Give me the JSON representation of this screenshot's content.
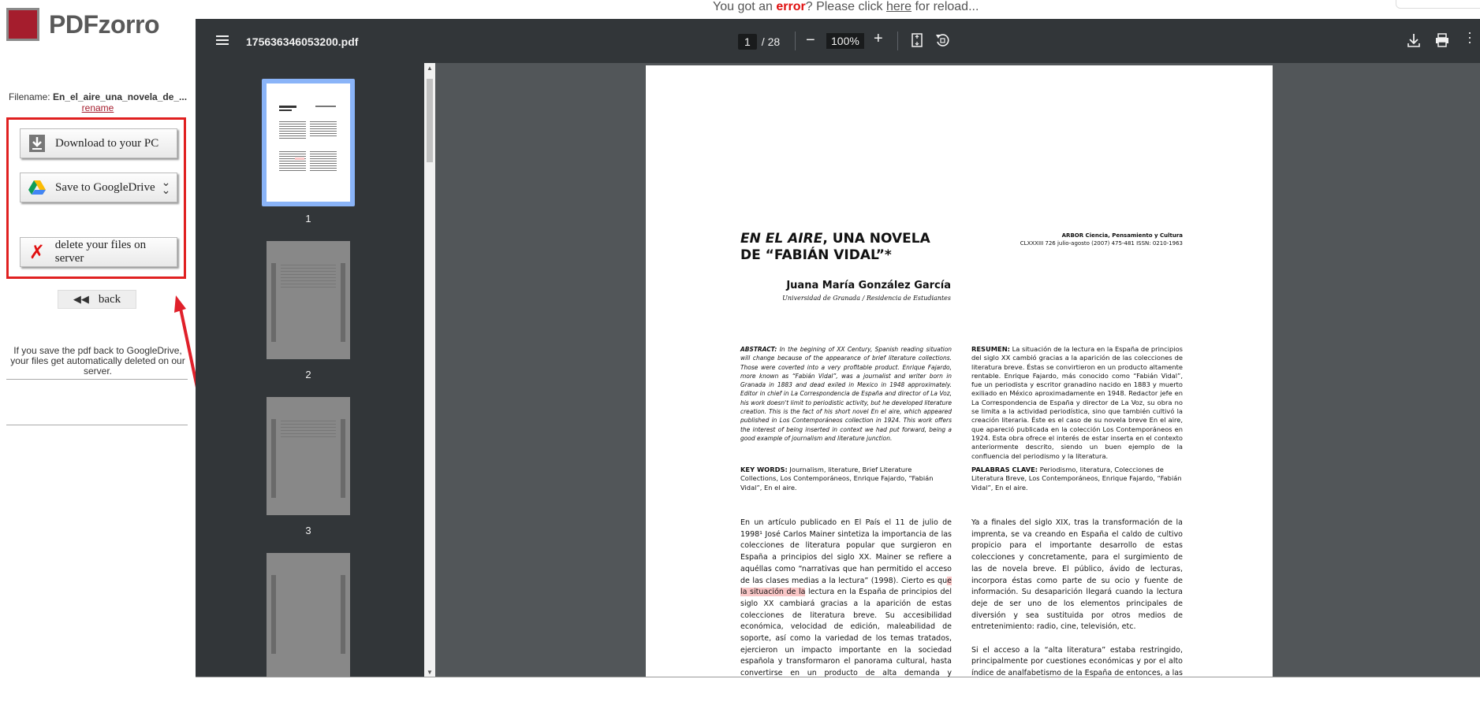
{
  "brand": {
    "name": "PDFzorro"
  },
  "notice": {
    "prefix": "You got an ",
    "error": "error",
    "middle": "? Please click ",
    "link": "here",
    "suffix": " for reload..."
  },
  "left": {
    "filename_label": "Filename:",
    "filename_value": "En_el_aire_una_novela_de_...",
    "rename": "rename",
    "download": "Download to your PC",
    "gdrive": "Save to GoogleDrive",
    "delete": "delete your files on server",
    "back": "back",
    "note": "If you save the pdf back to GoogleDrive, your files get automatically deleted on our server."
  },
  "viewer": {
    "file": "175636346053200.pdf",
    "page_current": "1",
    "page_total": "/ 28",
    "zoom": "100%",
    "thumb_labels": [
      "1",
      "2",
      "3"
    ]
  },
  "doc": {
    "title_italic": "EN EL AIRE",
    "title_rest": ", UNA NOVELA",
    "title_line2": "DE “FABIÁN VIDAL”*",
    "arbor1": "ARBOR Ciencia, Pensamiento y Cultura",
    "arbor2": "CLXXXIII 726 julio-agosto (2007) 475-481 ISSN: 0210-1963",
    "author": "Juana María González García",
    "affiliation": "Universidad de Granada / Residencia de Estudiantes",
    "abstract_label": "ABSTRACT:",
    "abstract": "In the begining of XX Century, Spanish reading situation will change because of the appearance of brief literature collections. Those were coverted into a very profitable product. Enrique Fajardo, more known as “Fabián Vidal”, was a journalist and writer born in Granada in 1883 and dead exiled in Mexico in 1948 approximately. Editor in chief in La Correspondencia de España and director of La Voz, his work doesn't limit to periodistic activity, but he developed literature creation. This is the fact of his short novel En el aire, which appeared published in Los Contemporáneos collection in 1924. This work offers the interest of being inserted in context we had put forward, being a good example of journalism and literature junction.",
    "keywords_label": "KEY WORDS:",
    "keywords": "Journalism, literature, Brief Literature Collections, Los Contemporáneos, Enrique Fajardo, “Fabián Vidal”, En el aire.",
    "resumen_label": "RESUMEN:",
    "resumen": "La situación de la lectura en la España de principios del siglo XX cambió gracias a la aparición de las colecciones de literatura breve. Éstas se convirtieron en un producto altamente rentable. Enrique Fajardo, más conocido como “Fabián Vidal”, fue un periodista y escritor granadino nacido en 1883 y muerto exiliado en México aproximadamente en 1948. Redactor jefe en La Correspondencia de España y director de La Voz, su obra no se limita a la actividad periodística, sino que también cultivó la creación literaria. Éste es el caso de su novela breve En el aire, que apareció publicada en la colección Los Contemporáneos en 1924. Esta obra ofrece el interés de estar inserta en el contexto anteriormente descrito, siendo un buen ejemplo de la confluencia del periodismo y la literatura.",
    "palabras_label": "PALABRAS CLAVE:",
    "palabras": "Periodismo, literatura, Colecciones de Literatura Breve, Los Contemporáneos, Enrique Fajardo, “Fabián Vidal”, En el aire.",
    "body1a": "En un artículo publicado en El País el 11 de julio de 1998¹ José Carlos Mainer sintetiza la importancia de las colecciones de literatura popular que surgieron en España a principios del siglo XX. Mainer se refiere a aquéllas como “narrativas que han permitido el acceso de las clases medias a la lectura” (1998). Cierto es qu",
    "body1hl": "e la situación de la",
    "body1b": " lectura en la España de principios del siglo XX cambiará gracias a la aparición de estas colecciones de literatura breve. Su accesibilidad económica, velocidad de edición, maleabilidad de soporte, así como la variedad de los temas tratados, ejercieron un impacto importante en la sociedad española y transformaron el panorama cultural, hasta convertirse en un producto de alta demanda y rentabilidad.",
    "body2a": "Ya a finales del siglo XIX, tras la transformación de la imprenta, se va creando en España el caldo de cultivo propicio para el importante desarrollo de estas colecciones y concretamente, para el surgimiento de las de novela breve. El público, ávido de lecturas, incorpora éstas como parte de su ocio y fuente de información. Su desaparición llegará cuando la lectura deje de ser uno de los elementos principales de diversión y sea sustituida por otros medios de entretenimiento: radio, cine, televisión, etc.",
    "body2b": "Si el acceso a la “alta literatura” estaba restringido, principalmente por cuestiones económicas y por el alto índice de analfabetismo de la España de entonces, a las clases pudientes, estas colecciones ponen a disposición de un público mucho"
  },
  "colors": {
    "brand": "#a51d2d",
    "toolbar": "#323639",
    "viewer_bg": "#525659",
    "highlight": "#e02020"
  }
}
